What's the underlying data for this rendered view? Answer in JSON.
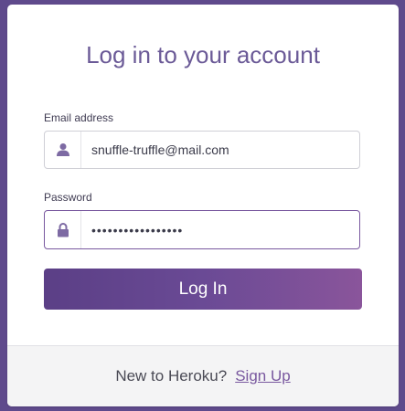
{
  "card": {
    "title": "Log in to your account",
    "email": {
      "label": "Email address",
      "value": "snuffle-truffle@mail.com",
      "icon": "user-icon"
    },
    "password": {
      "label": "Password",
      "value": "•••••••••••••••••",
      "icon": "lock-icon"
    },
    "submit_label": "Log In",
    "footer": {
      "text": "New to Heroku?",
      "link": "Sign Up"
    }
  },
  "colors": {
    "background": "#5f4a8c",
    "accent": "#79589f",
    "title": "#6b5a97"
  }
}
